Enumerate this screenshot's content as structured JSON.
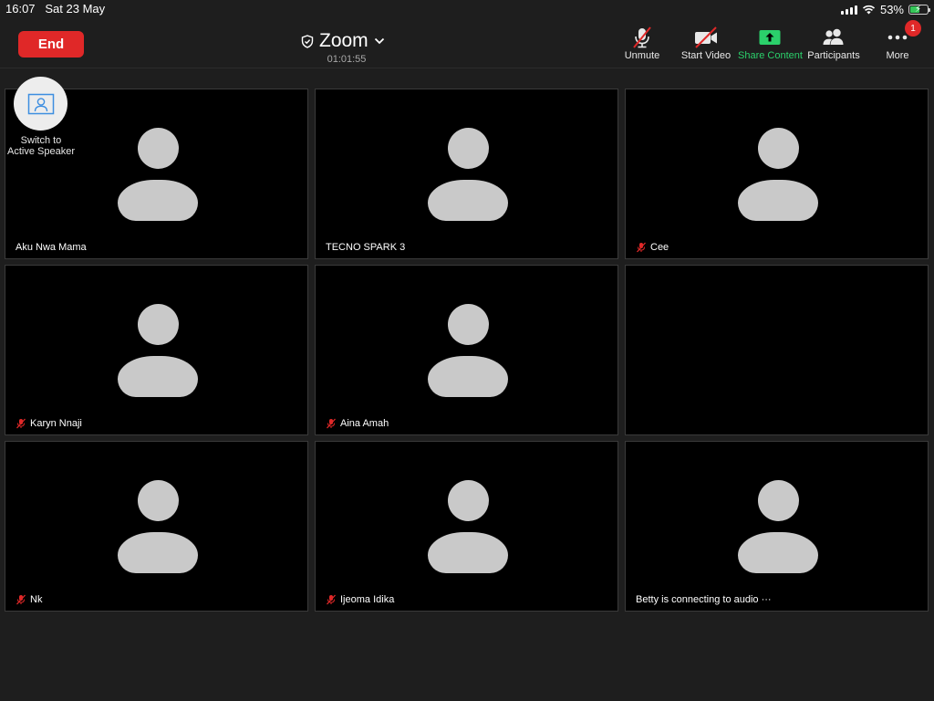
{
  "status_bar": {
    "time": "16:07",
    "date": "Sat 23 May",
    "battery_percent": "53%",
    "battery_level": 0.53
  },
  "toolbar": {
    "end_label": "End",
    "meeting_name": "Zoom",
    "timer": "01:01:55",
    "unmute_label": "Unmute",
    "start_video_label": "Start Video",
    "share_label": "Share Content",
    "participants_label": "Participants",
    "more_label": "More",
    "more_badge": "1"
  },
  "switch_speaker": {
    "line1": "Switch to",
    "line2": "Active Speaker"
  },
  "participants": [
    {
      "name": "Aku Nwa Mama",
      "muted": false
    },
    {
      "name": "TECNO SPARK 3",
      "muted": false
    },
    {
      "name": "Cee",
      "muted": true
    },
    {
      "name": "Karyn Nnaji",
      "muted": true
    },
    {
      "name": "Aina Amah",
      "muted": true
    },
    {
      "name": "",
      "muted": false
    },
    {
      "name": "Nk",
      "muted": true
    },
    {
      "name": "Ijeoma Idika",
      "muted": true
    },
    {
      "name": "Betty is connecting to audio ···",
      "muted": false
    }
  ],
  "colors": {
    "end": "#e02828",
    "share": "#2bd06b",
    "muted_icon": "#e02828",
    "avatar": "#c9c9c9"
  }
}
